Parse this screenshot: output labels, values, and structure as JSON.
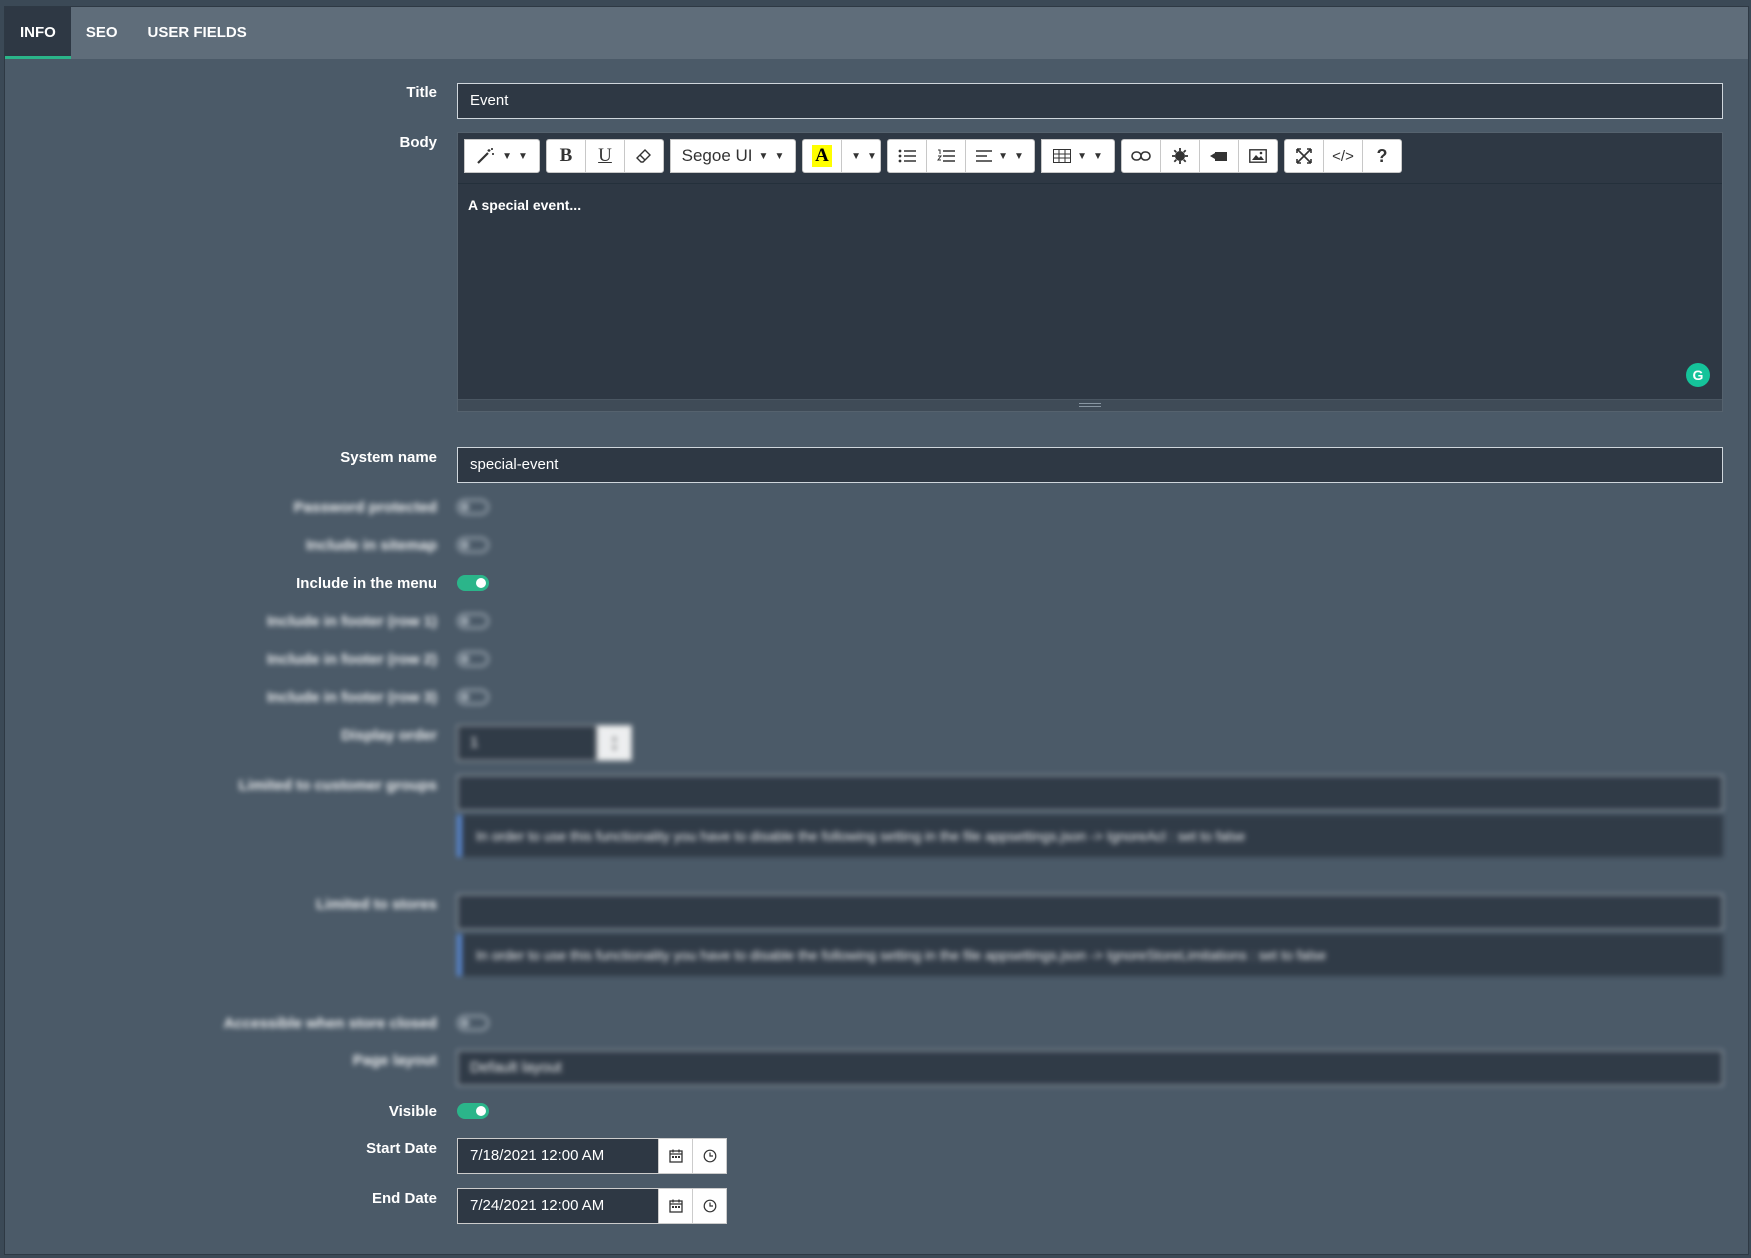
{
  "tabs": [
    {
      "label": "INFO",
      "active": true
    },
    {
      "label": "SEO",
      "active": false
    },
    {
      "label": "USER FIELDS",
      "active": false
    }
  ],
  "form": {
    "title": {
      "label": "Title",
      "value": "Event"
    },
    "body": {
      "label": "Body",
      "content": "A special event...",
      "toolbar": {
        "font": "Segoe UI",
        "highlight_letter": "A"
      }
    },
    "system_name": {
      "label": "System name",
      "value": "special-event"
    },
    "password_protected": {
      "label": "Password protected",
      "on": false
    },
    "include_in_sitemap": {
      "label": "Include in sitemap",
      "on": false
    },
    "include_in_menu": {
      "label": "Include in the menu",
      "on": true
    },
    "footer_row1": {
      "label": "Include in footer (row 1)",
      "on": false
    },
    "footer_row2": {
      "label": "Include in footer (row 2)",
      "on": false
    },
    "footer_row3": {
      "label": "Include in footer (row 3)",
      "on": false
    },
    "display_order": {
      "label": "Display order",
      "value": "1"
    },
    "customer_groups": {
      "label": "Limited to customer groups",
      "note": "In order to use this functionality you have to disable the following setting in the file appsettings.json -> IgnoreAcl : set to false"
    },
    "stores": {
      "label": "Limited to stores",
      "note": "In order to use this functionality you have to disable the following setting in the file appsettings.json -> IgnoreStoreLimitations : set to false"
    },
    "accessible_when_closed": {
      "label": "Accessible when store closed",
      "on": false
    },
    "page_layout": {
      "label": "Page layout",
      "value": "Default layout"
    },
    "visible": {
      "label": "Visible",
      "on": true
    },
    "start_date": {
      "label": "Start Date",
      "value": "7/18/2021 12:00 AM"
    },
    "end_date": {
      "label": "End Date",
      "value": "7/24/2021 12:00 AM"
    }
  },
  "colors": {
    "accent": "#2bb58a",
    "panel": "#4b5a68",
    "input_bg": "#2e3844",
    "tab_bar": "#5f6d7a",
    "grammarly": "#15c39a"
  }
}
